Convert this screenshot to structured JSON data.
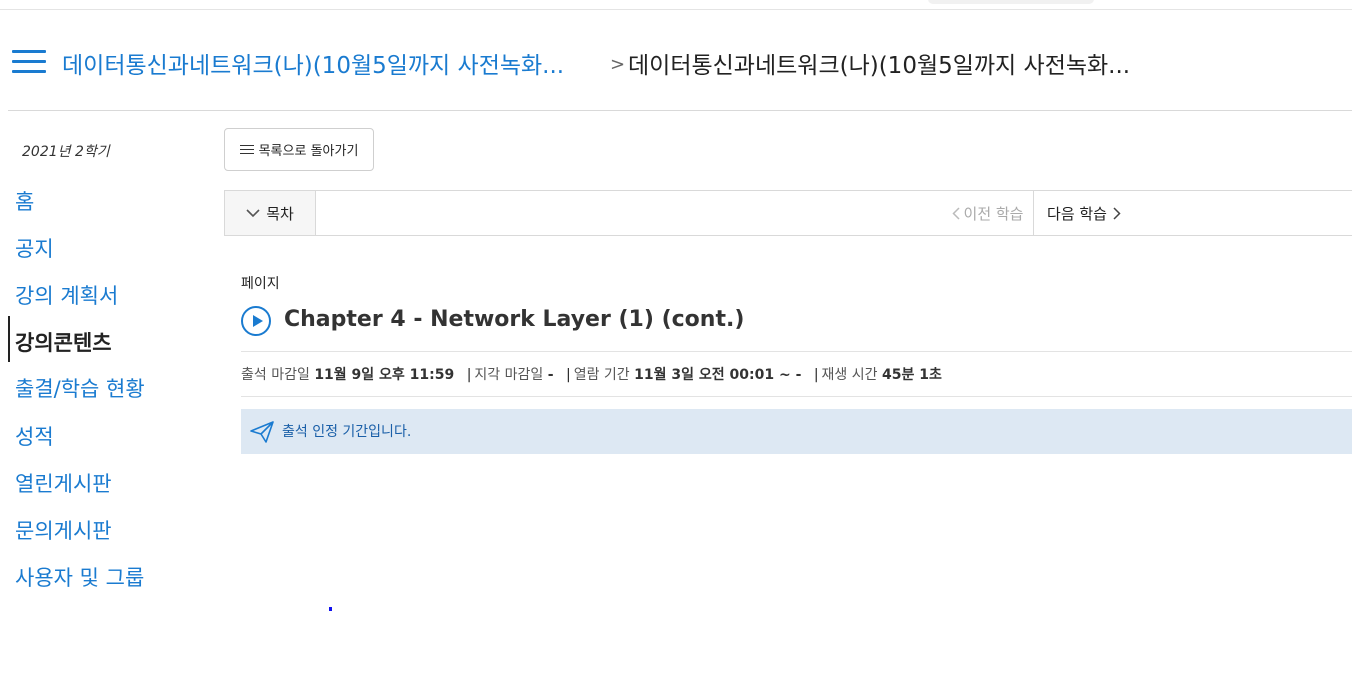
{
  "header": {
    "breadcrumb_link": "데이터통신과네트워크(나)(10월5일까지 사전녹화...",
    "breadcrumb_separator": ">",
    "breadcrumb_current": "데이터통신과네트워크(나)(10월5일까지 사전녹화..."
  },
  "sidebar": {
    "term": "2021년 2학기",
    "items": [
      {
        "label": "홈",
        "active": false
      },
      {
        "label": "공지",
        "active": false
      },
      {
        "label": "강의 계획서",
        "active": false
      },
      {
        "label": "강의콘텐츠",
        "active": true
      },
      {
        "label": "출결/학습 현황",
        "active": false
      },
      {
        "label": "성적",
        "active": false
      },
      {
        "label": "열린게시판",
        "active": false
      },
      {
        "label": "문의게시판",
        "active": false
      },
      {
        "label": "사용자 및 그룹",
        "active": false
      }
    ]
  },
  "toolbar": {
    "back_label": "목록으로 돌아가기",
    "toc_label": "목차",
    "prev_label": "이전 학습",
    "next_label": "다음 학습"
  },
  "content": {
    "type_label": "페이지",
    "title": "Chapter 4 - Network Layer (1) (cont.)",
    "meta": {
      "deadline_label": "출석 마감일",
      "deadline_value": "11월 9일 오후 11:59",
      "late_label": "지각 마감일",
      "late_value": "-",
      "open_label": "열람 기간",
      "open_value": "11월 3일 오전 00:01 ~ -",
      "play_label": "재생 시간",
      "play_value": "45분 1초"
    },
    "notice": "출석 인정 기간입니다."
  },
  "colors": {
    "accent": "#1a7bd0",
    "notice_bg": "#dde8f3"
  },
  "icons": [
    "hamburger-menu-icon",
    "chevron-right-icon",
    "list-icon",
    "chevron-down-icon",
    "chevron-left-icon",
    "play-circle-icon",
    "paper-plane-icon"
  ]
}
